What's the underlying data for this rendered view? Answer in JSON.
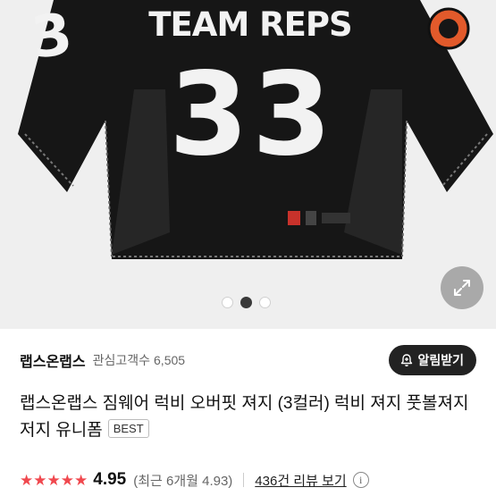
{
  "gallery": {
    "jersey_text": "TEAM REPS",
    "jersey_number": "33",
    "sleeve_number": "3",
    "slide_count": 3,
    "active_slide": 2
  },
  "store": {
    "name": "랩스온랩스",
    "followers_label": "관심고객수",
    "followers_count": "6,505",
    "alert_label": "알림받기"
  },
  "product": {
    "title": "랩스온랩스 짐웨어 럭비 오버핏 져지 (3컬러) 럭비 져지 풋볼져지 저지 유니폼",
    "badge": "BEST"
  },
  "rating": {
    "stars": 5,
    "score": "4.95",
    "recent": "(최근 6개월 4.93)",
    "reviews_link": "436건 리뷰 보기",
    "info": "i"
  },
  "colors": {
    "star": "#f0484e",
    "jersey": "#161616",
    "number": "#f2f2f2"
  }
}
